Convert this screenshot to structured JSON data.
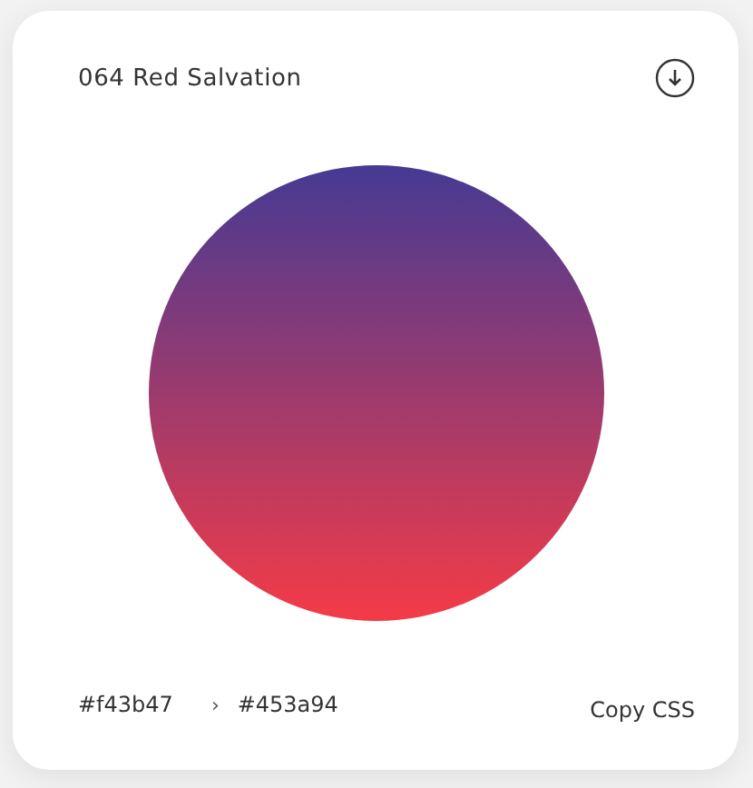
{
  "title": "064 Red Salvation",
  "gradient": {
    "from": "#f43b47",
    "separator": "›",
    "to": "#453a94"
  },
  "copy_button": {
    "label": "Copy CSS"
  }
}
